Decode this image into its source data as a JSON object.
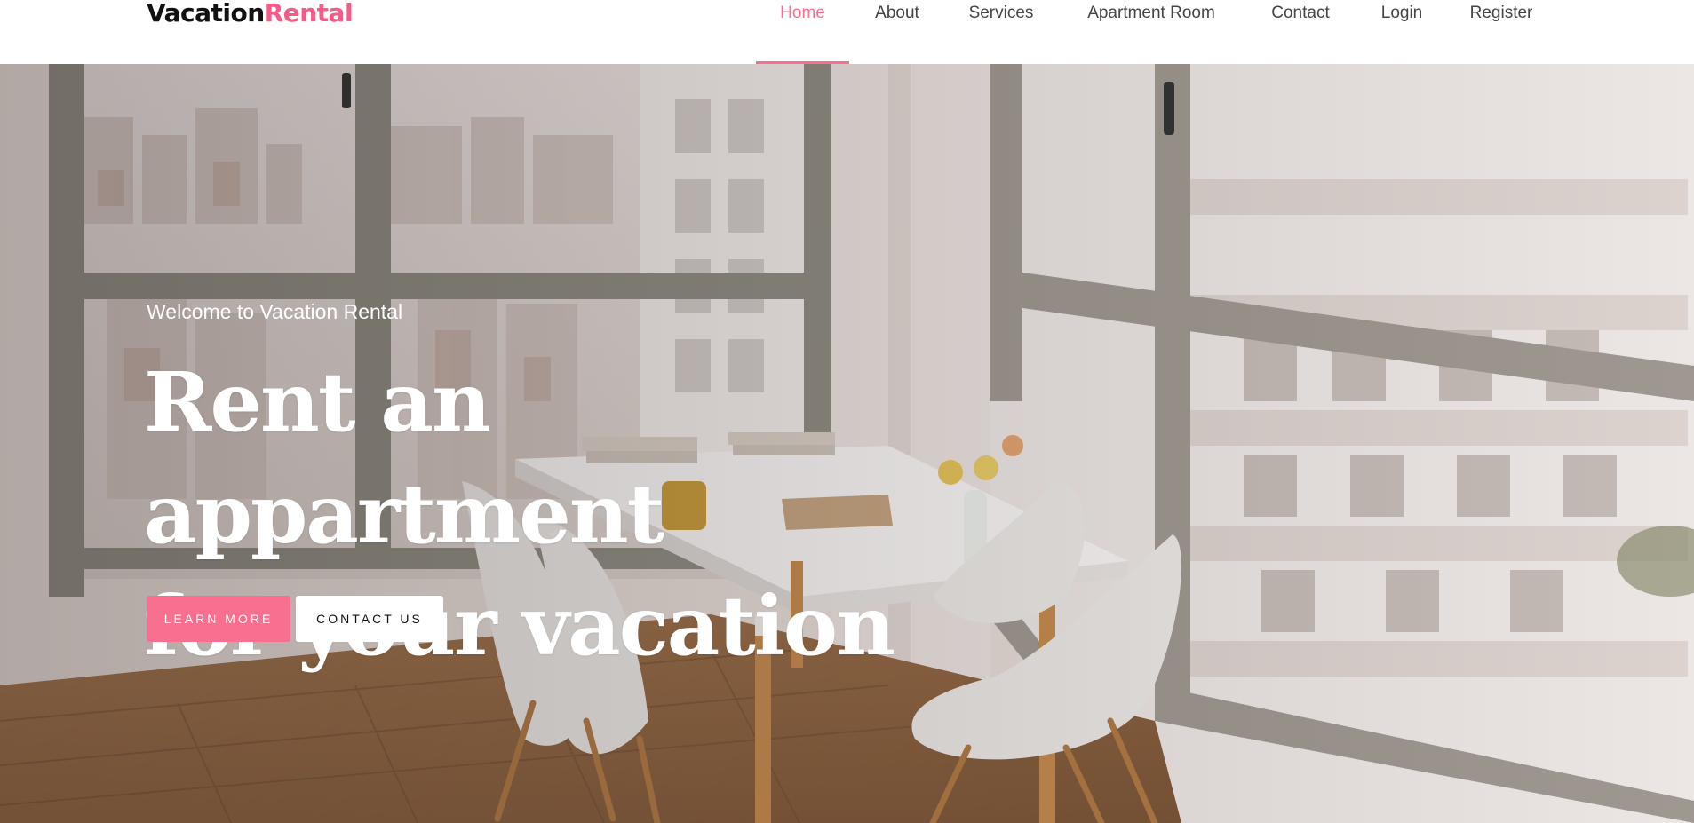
{
  "brand": {
    "name_part1": "Vacation",
    "name_part2": "Rental",
    "accent_color": "#f86f90"
  },
  "nav": {
    "items": [
      {
        "label": "Home",
        "active": true
      },
      {
        "label": "About",
        "active": false
      },
      {
        "label": "Services",
        "active": false
      },
      {
        "label": "Apartment Room",
        "active": false
      },
      {
        "label": "Contact",
        "active": false
      },
      {
        "label": "Login",
        "active": false
      },
      {
        "label": "Register",
        "active": false
      }
    ]
  },
  "hero": {
    "subtitle": "Welcome to Vacation Rental",
    "headline_line1": "Rent an appartment",
    "headline_line2": "for your vacation",
    "primary_button": "LEARN MORE",
    "secondary_button": "CONTACT US",
    "background": "apartment-dining-room-photo"
  }
}
